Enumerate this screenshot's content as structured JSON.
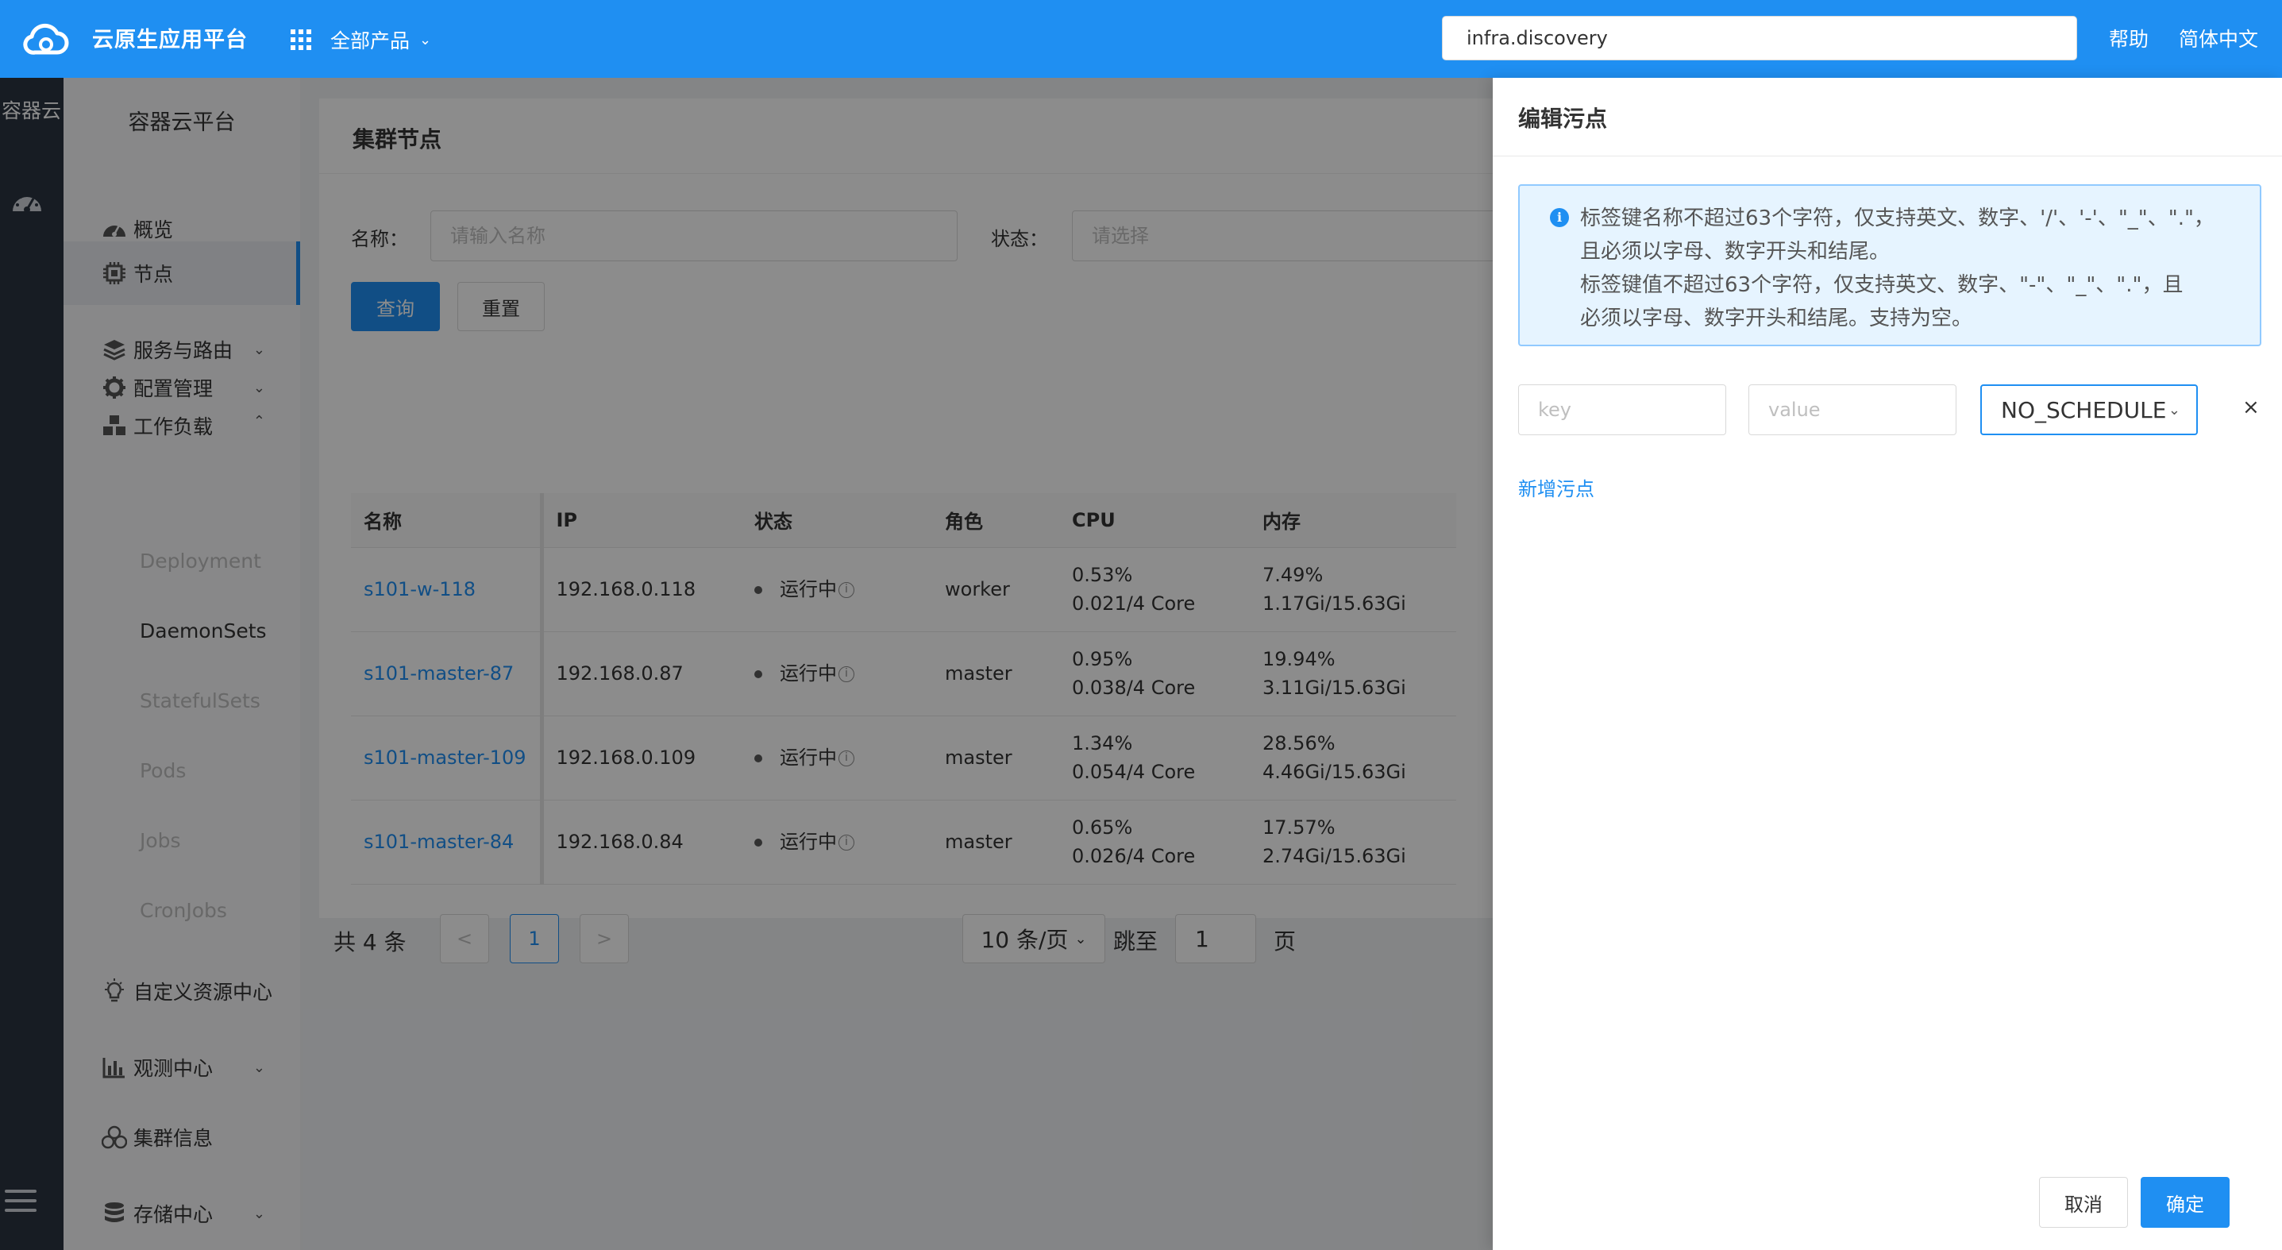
{
  "topbar": {
    "brand": "云原生应用平台",
    "all_products": "全部产品",
    "search_value": "infra.discovery",
    "help": "帮助",
    "language": "简体中文"
  },
  "rail": {
    "title": "容器云"
  },
  "sidebar": {
    "title": "容器云平台",
    "items": [
      {
        "label": "概览",
        "icon": "dashboard-icon"
      },
      {
        "label": "节点",
        "icon": "chip-icon"
      },
      {
        "label": "服务与路由",
        "icon": "layers-icon"
      },
      {
        "label": "配置管理",
        "icon": "gear-icon"
      },
      {
        "label": "工作负载",
        "icon": "cubes-icon"
      },
      {
        "label": "自定义资源中心",
        "icon": "bulb-icon"
      },
      {
        "label": "观测中心",
        "icon": "bar-chart-icon"
      },
      {
        "label": "集群信息",
        "icon": "cluster-icon"
      },
      {
        "label": "存储中心",
        "icon": "database-icon"
      }
    ],
    "workload_children": [
      "Deployment",
      "DaemonSets",
      "StatefulSets",
      "Pods",
      "Jobs",
      "CronJobs"
    ]
  },
  "page": {
    "title": "集群节点",
    "filter": {
      "name_label": "名称：",
      "name_placeholder": "请输入名称",
      "status_label": "状态：",
      "status_placeholder": "请选择"
    },
    "query_button": "查询",
    "reset_button": "重置"
  },
  "table": {
    "columns": [
      "名称",
      "IP",
      "状态",
      "角色",
      "CPU",
      "内存"
    ],
    "rows": [
      {
        "name": "s101-w-118",
        "ip": "192.168.0.118",
        "status": "运行中",
        "role": "worker",
        "cpu_pct": "0.53%",
        "cpu_detail": "0.021/4 Core",
        "mem_pct": "7.49%",
        "mem_detail": "1.17Gi/15.63Gi"
      },
      {
        "name": "s101-master-87",
        "ip": "192.168.0.87",
        "status": "运行中",
        "role": "master",
        "cpu_pct": "0.95%",
        "cpu_detail": "0.038/4 Core",
        "mem_pct": "19.94%",
        "mem_detail": "3.11Gi/15.63Gi"
      },
      {
        "name": "s101-master-109",
        "ip": "192.168.0.109",
        "status": "运行中",
        "role": "master",
        "cpu_pct": "1.34%",
        "cpu_detail": "0.054/4 Core",
        "mem_pct": "28.56%",
        "mem_detail": "4.46Gi/15.63Gi"
      },
      {
        "name": "s101-master-84",
        "ip": "192.168.0.84",
        "status": "运行中",
        "role": "master",
        "cpu_pct": "0.65%",
        "cpu_detail": "0.026/4 Core",
        "mem_pct": "17.57%",
        "mem_detail": "2.74Gi/15.63Gi"
      }
    ]
  },
  "pagination": {
    "total": "共 4 条",
    "prev": "<",
    "current": "1",
    "next": ">",
    "page_size": "10 条/页",
    "jump_label": "跳至",
    "jump_value": "1",
    "page_suffix": "页"
  },
  "drawer": {
    "title": "编辑污点",
    "info_lines": [
      "标签键名称不超过63个字符，仅支持英文、数字、'/'、'-'、\"_\"、\".\"，",
      "且必须以字母、数字开头和结尾。",
      "标签键值不超过63个字符，仅支持英文、数字、\"-\"、\"_\"、\".\"，且",
      "必须以字母、数字开头和结尾。支持为空。"
    ],
    "key_placeholder": "key",
    "value_placeholder": "value",
    "effect": "NO_SCHEDULE",
    "remove": "×",
    "add_taint": "新增污点",
    "cancel": "取消",
    "ok": "确定"
  },
  "colors": {
    "primary": "#1f8ff2",
    "rail": "#2b3441",
    "sidebar": "#f7f8fa",
    "info_bg": "#e6f4ff",
    "info_border": "#91caff"
  }
}
